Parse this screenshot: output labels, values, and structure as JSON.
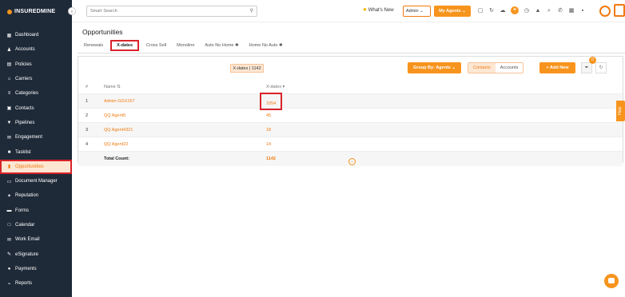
{
  "app": {
    "logo_text": "INSUREDMINE"
  },
  "sidebar": {
    "items": [
      {
        "label": "Dashboard",
        "icon": "dashboard-icon"
      },
      {
        "label": "Accounts",
        "icon": "accounts-icon"
      },
      {
        "label": "Policies",
        "icon": "policies-icon"
      },
      {
        "label": "Carriers",
        "icon": "carriers-icon"
      },
      {
        "label": "Categories",
        "icon": "categories-icon"
      },
      {
        "label": "Contacts",
        "icon": "contacts-icon"
      },
      {
        "label": "Pipelines",
        "icon": "pipelines-icon"
      },
      {
        "label": "Engagement",
        "icon": "engagement-icon"
      },
      {
        "label": "Tasklist",
        "icon": "tasklist-icon"
      },
      {
        "label": "Opportunities",
        "icon": "opportunities-icon",
        "active": true
      },
      {
        "label": "Document Manager",
        "icon": "folder-icon"
      },
      {
        "label": "Reputation",
        "icon": "reputation-icon"
      },
      {
        "label": "Forms",
        "icon": "forms-icon"
      },
      {
        "label": "Calendar",
        "icon": "calendar-icon"
      },
      {
        "label": "Work Email",
        "icon": "email-icon"
      },
      {
        "label": "eSignature",
        "icon": "signature-icon"
      },
      {
        "label": "Payments",
        "icon": "payments-icon"
      },
      {
        "label": "Reports",
        "icon": "reports-icon"
      }
    ]
  },
  "topbar": {
    "search_placeholder": "Smart Search",
    "whats_new": "What's New",
    "admin_select": "Admin",
    "my_agents": "My Agents"
  },
  "page": {
    "title": "Opportunities",
    "tabs": [
      "Renewals",
      "X-dates",
      "Cross Sell",
      "Monoline",
      "Auto No Home",
      "Home No Auto"
    ],
    "active_tab": "X-dates"
  },
  "toolbar": {
    "chip": "X-dates | 1142",
    "group_by": "Group By: Agents",
    "seg_contacts": "Contacts",
    "seg_accounts": "Accounts",
    "add_new": "+ Add New",
    "filter_badge": "0"
  },
  "table": {
    "headers": {
      "idx": "#",
      "name": "Name",
      "xdates": "X-dates"
    },
    "rows": [
      {
        "idx": "1",
        "name": "Admin GGX157",
        "xdates": "1054"
      },
      {
        "idx": "2",
        "name": "QQ Agent5",
        "xdates": "45"
      },
      {
        "idx": "3",
        "name": "QQ Agent4321",
        "xdates": "18"
      },
      {
        "idx": "4",
        "name": "QQ Agent22",
        "xdates": "14"
      }
    ],
    "total_label": "Total Count:",
    "total_value": "1142"
  },
  "help_tab": "Help",
  "colors": {
    "accent": "#f7941d",
    "sidebar_bg": "#1f2a38",
    "highlight": "#d8232a"
  }
}
